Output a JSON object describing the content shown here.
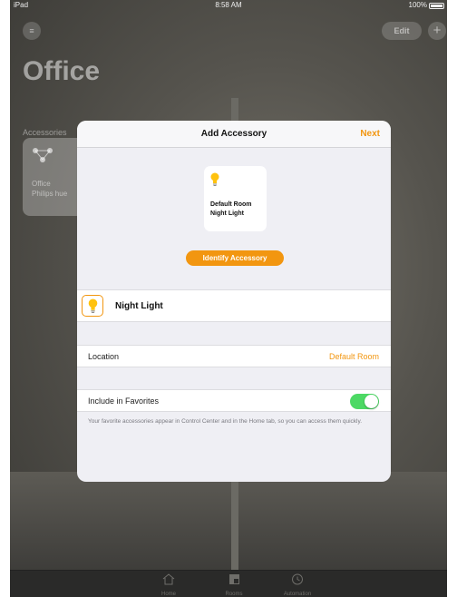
{
  "status_bar": {
    "device": "iPad",
    "time": "8:58 AM",
    "battery": "100%"
  },
  "top_bar": {
    "edit_label": "Edit",
    "add_label": "+"
  },
  "room": {
    "title": "Office",
    "section_label": "Accessories",
    "tile": {
      "line1": "Office",
      "line2": "Philips hue"
    }
  },
  "modal": {
    "title": "Add Accessory",
    "next_label": "Next",
    "preview": {
      "line1": "Default Room",
      "line2": "Night Light"
    },
    "identify_label": "Identify Accessory",
    "name_value": "Night Light",
    "location_label": "Location",
    "location_value": "Default Room",
    "favorites_label": "Include in Favorites",
    "favorites_on": true,
    "favorites_note": "Your favorite accessories appear in Control Center and in the Home tab, so you can access them quickly."
  },
  "tab_bar": {
    "tabs": [
      {
        "label": "Home",
        "icon": "house-icon"
      },
      {
        "label": "Rooms",
        "icon": "rooms-icon"
      },
      {
        "label": "Automation",
        "icon": "clock-icon"
      }
    ]
  },
  "colors": {
    "accent": "#f29610",
    "toggle_on": "#4cd964",
    "bulb": "#ffc20e"
  }
}
